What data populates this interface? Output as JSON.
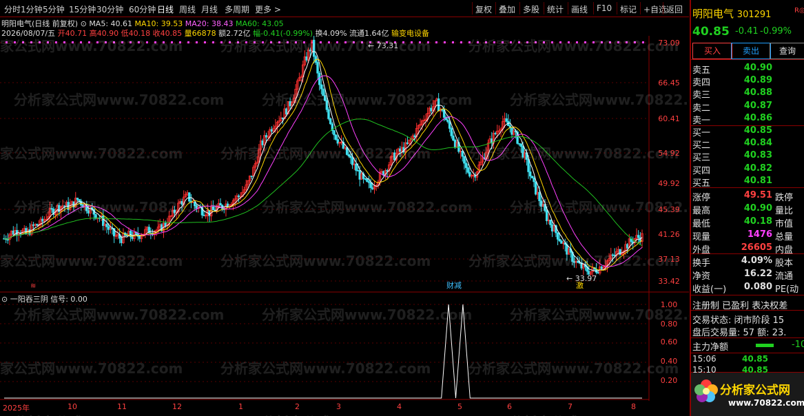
{
  "toolbar": {
    "periods": [
      "分时",
      "1分钟",
      "5分钟",
      "15分钟",
      "30分钟",
      "60分钟",
      "日线",
      "周线",
      "月线",
      "多周期",
      "更多 >"
    ],
    "actions": [
      "复权",
      "叠加",
      "多股",
      "统计",
      "画线",
      "F10",
      "标记",
      "+自选",
      "返回"
    ]
  },
  "chart_header": {
    "title": "明阳电气(日线 前复权)",
    "ma5": "MA5: 40.61",
    "ma10": "MA10: 39.53",
    "ma20": "MA20: 38.43",
    "ma60": "MA60: 43.05",
    "date": "2026/08/07/五",
    "open": "开40.71",
    "high": "高40.90",
    "low": "低40.18",
    "close": "收40.85",
    "volume": "量66878",
    "amount": "额2.72亿",
    "change": "幅-0.41(-0.99%)",
    "turnover": "换4.09%",
    "float": "流通1.64亿",
    "sector": "输变电设备"
  },
  "price_axis": [
    "73.09",
    "66.45",
    "60.41",
    "54.92",
    "49.92",
    "45.39",
    "41.26",
    "37.13",
    "33.42"
  ],
  "indicator": {
    "name": "一阳吞三阴",
    "signal": "信号: 0.00",
    "axis": [
      "1.00",
      "0.80",
      "0.60",
      "0.40",
      "0.20"
    ]
  },
  "annotations": {
    "peak": "73.31",
    "trough": "33.97",
    "event1": "财减",
    "event2": "激"
  },
  "date_axis": [
    "2025年",
    "10",
    "11",
    "12",
    "1",
    "2",
    "3",
    "4",
    "5",
    "6",
    "7",
    "8"
  ],
  "watermark": "分析家公式网www.70822.com",
  "stock": {
    "name": "明阳电气",
    "code": "301291",
    "badge": "R",
    "price": "40.85",
    "change": "-0.41",
    "pct": "-0.99%"
  },
  "trade_buttons": [
    "买入",
    "卖出",
    "查询"
  ],
  "order_book": [
    {
      "label": "卖五",
      "value": "40.90"
    },
    {
      "label": "卖四",
      "value": "40.89"
    },
    {
      "label": "卖三",
      "value": "40.88"
    },
    {
      "label": "卖二",
      "value": "40.87"
    },
    {
      "label": "卖一",
      "value": "40.86"
    },
    {
      "label": "买一",
      "value": "40.85"
    },
    {
      "label": "买二",
      "value": "40.84"
    },
    {
      "label": "买三",
      "value": "40.83"
    },
    {
      "label": "买四",
      "value": "40.82"
    },
    {
      "label": "买五",
      "value": "40.81"
    }
  ],
  "stats": [
    {
      "label": "涨停",
      "value": "49.51",
      "label2": "跌停"
    },
    {
      "label": "最高",
      "value": "40.90",
      "label2": "量比"
    },
    {
      "label": "最低",
      "value": "40.18",
      "label2": "市值"
    },
    {
      "label": "现量",
      "value": "1476",
      "label2": "总量"
    },
    {
      "label": "外盘",
      "value": "26605",
      "label2": "内盘"
    },
    {
      "label": "换手",
      "value": "4.09%",
      "label2": "股本"
    },
    {
      "label": "净资",
      "value": "16.22",
      "label2": "流通"
    },
    {
      "label": "收益(一)",
      "value": "0.080",
      "label2": "PE(动"
    }
  ],
  "extra": {
    "line1": "注册制 已盈利 表决权差",
    "line2": "交易状态: 闭市阶段 15",
    "line3": "盘后交易量: 57  额: 23.",
    "main_net": "主力净额",
    "main_net_val": "-10"
  },
  "ticks": [
    {
      "time": "15:06",
      "price": "40.85"
    },
    {
      "time": "15:10",
      "price": "40.85"
    }
  ],
  "logo": {
    "text": "分析家公式网",
    "url": "www.70822.com"
  },
  "chart_data": {
    "type": "candlestick",
    "x": [
      "2025年",
      "10",
      "11",
      "12",
      "1",
      "2",
      "3",
      "4",
      "5",
      "6",
      "7",
      "8"
    ],
    "ylim": [
      33.42,
      73.09
    ],
    "series": [
      {
        "name": "MA5",
        "values": [
          40.61
        ]
      },
      {
        "name": "MA10",
        "values": [
          39.53
        ]
      },
      {
        "name": "MA20",
        "values": [
          38.43
        ]
      },
      {
        "name": "MA60",
        "values": [
          43.05
        ]
      }
    ],
    "close_path": [
      40.5,
      41.5,
      42,
      41.2,
      42.5,
      43,
      44.5,
      45.5,
      46,
      45.8,
      47,
      46,
      45,
      44,
      42.5,
      41,
      40.5,
      41,
      40.8,
      41.5,
      42,
      41.8,
      43,
      44.5,
      46.5,
      47.5,
      46,
      45.2,
      44.8,
      45.5,
      46,
      46.8,
      47.5,
      49,
      52,
      56,
      58,
      60,
      61,
      63,
      66,
      70,
      72.8,
      66,
      62,
      58,
      56,
      54,
      52,
      50,
      49,
      50.5,
      52,
      54,
      55,
      56,
      58,
      60,
      62,
      63,
      61,
      58,
      55,
      52,
      51,
      53,
      56,
      58,
      60,
      59,
      57,
      54,
      50,
      47,
      44,
      42,
      40,
      38,
      36.5,
      35.5,
      35,
      35.5,
      36.5,
      37.5,
      38.5,
      39.5,
      40.5,
      40.85
    ],
    "indicator_signal": [
      0,
      0,
      0,
      0,
      0,
      0,
      0,
      0,
      0,
      0,
      0,
      0,
      0,
      0,
      0,
      0,
      0,
      0,
      0,
      0,
      0,
      0,
      0,
      0,
      0,
      0,
      0,
      0,
      0,
      0,
      0,
      0,
      0,
      0,
      0,
      0,
      0,
      0,
      0,
      0,
      0,
      0,
      0,
      0,
      0,
      0,
      0,
      0,
      0,
      0,
      0,
      0,
      0,
      0,
      0,
      0,
      0,
      0,
      0,
      0,
      0,
      0,
      1,
      0,
      1,
      0,
      0,
      0,
      0,
      0,
      0,
      0,
      0,
      0,
      0,
      0,
      0,
      0,
      0,
      0,
      0,
      0,
      0,
      0,
      0,
      0,
      0,
      0,
      0,
      0
    ]
  }
}
